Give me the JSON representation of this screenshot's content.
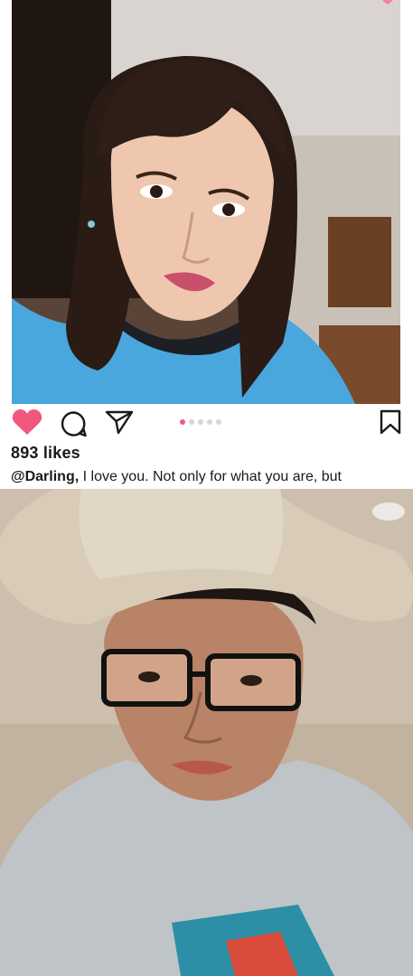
{
  "post": {
    "photo_subject": "woman-selfie",
    "likes": "893 likes",
    "caption_user": "@Darling,",
    "caption_text": " I love you. Not only for what you are, but",
    "carousel": {
      "total": 5,
      "active": 0
    },
    "colors": {
      "heart": "#f3577e",
      "icon_stroke": "#1a1a1a",
      "dot_active": "#f3577e",
      "dot_inactive": "#d6d6d6"
    },
    "icons": {
      "like": "heart-icon",
      "comment": "comment-icon",
      "share": "paper-plane-icon",
      "save": "bookmark-icon"
    }
  },
  "second_photo": {
    "photo_subject": "man-in-cowboy-hat-selfie"
  }
}
